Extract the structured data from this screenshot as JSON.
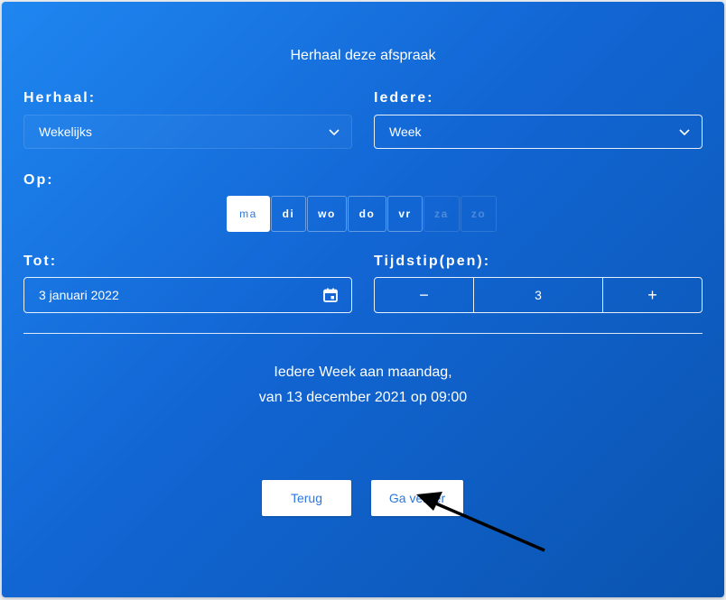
{
  "dialog": {
    "title": "Herhaal deze afspraak"
  },
  "repeat": {
    "label": "Herhaal:",
    "value": "Wekelijks",
    "icon": "chevron-down-icon"
  },
  "every": {
    "label": "Iedere:",
    "value": "Week",
    "icon": "chevron-down-icon"
  },
  "on": {
    "label": "Op:",
    "days": [
      {
        "label": "ma",
        "state": "active"
      },
      {
        "label": "di",
        "state": "enabled"
      },
      {
        "label": "wo",
        "state": "enabled"
      },
      {
        "label": "do",
        "state": "enabled"
      },
      {
        "label": "vr",
        "state": "enabled"
      },
      {
        "label": "za",
        "state": "disabled"
      },
      {
        "label": "zo",
        "state": "disabled"
      }
    ]
  },
  "until": {
    "label": "Tot:",
    "value": "3 januari 2022",
    "icon": "calendar-icon"
  },
  "times": {
    "label": "Tijdstip(pen):",
    "minus": "−",
    "value": "3",
    "plus": "+"
  },
  "summary": {
    "line1": "Iedere Week aan maandag,",
    "line2": "van 13 december 2021 op 09:00"
  },
  "actions": {
    "back": "Terug",
    "next": "Ga verder"
  },
  "colors": {
    "panel_start": "#1f86f0",
    "panel_end": "#0a54b0",
    "accent_text": "#2a78e0"
  }
}
